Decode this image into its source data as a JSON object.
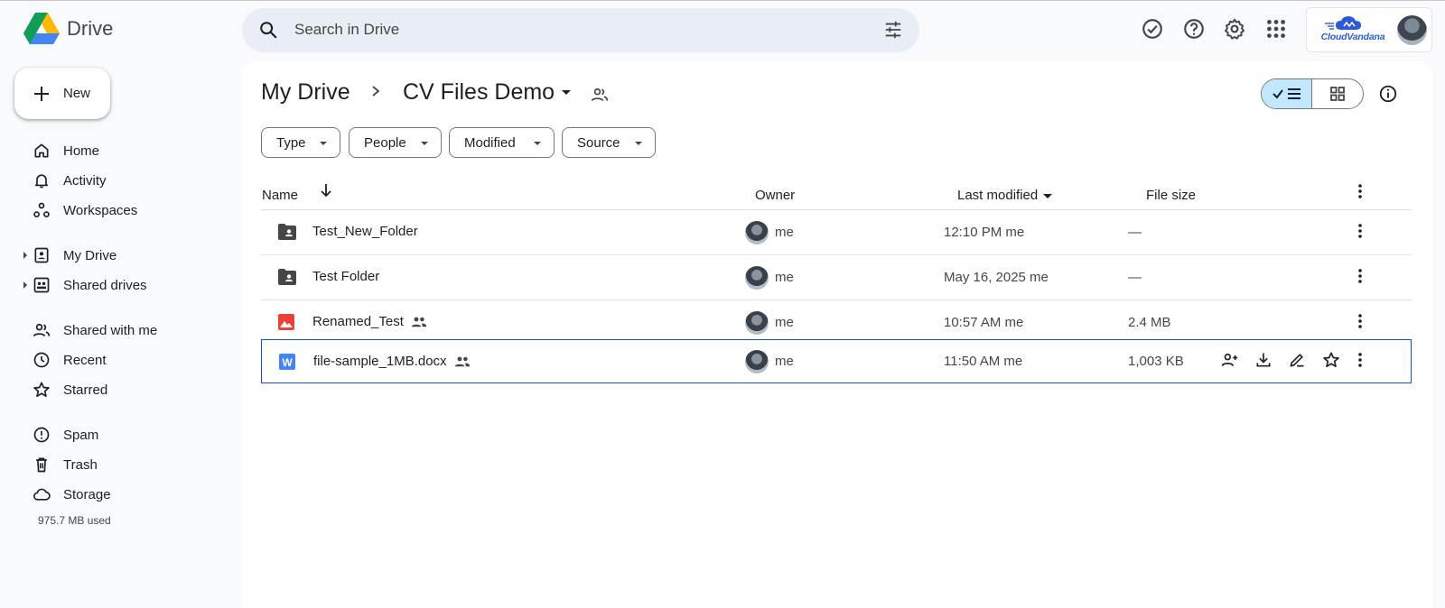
{
  "app": {
    "name": "Drive",
    "search_placeholder": "Search in Drive",
    "account_brand": "CloudVandana"
  },
  "new_button": {
    "label": "New"
  },
  "sidebar": {
    "items": [
      {
        "label": "Home"
      },
      {
        "label": "Activity"
      },
      {
        "label": "Workspaces"
      },
      {
        "label": "My Drive"
      },
      {
        "label": "Shared drives"
      },
      {
        "label": "Shared with me"
      },
      {
        "label": "Recent"
      },
      {
        "label": "Starred"
      },
      {
        "label": "Spam"
      },
      {
        "label": "Trash"
      },
      {
        "label": "Storage"
      }
    ],
    "storage_used": "975.7 MB used"
  },
  "breadcrumb": {
    "root": "My Drive",
    "current": "CV Files Demo"
  },
  "filters": [
    "Type",
    "People",
    "Modified",
    "Source"
  ],
  "table": {
    "headers": {
      "name": "Name",
      "owner": "Owner",
      "modified": "Last modified",
      "size": "File size"
    },
    "rows": [
      {
        "name": "Test_New_Folder",
        "owner": "me",
        "modified": "12:10 PM me",
        "size": "—"
      },
      {
        "name": "Test Folder",
        "owner": "me",
        "modified": "May 16, 2025 me",
        "size": "—"
      },
      {
        "name": "Renamed_Test",
        "owner": "me",
        "modified": "10:57 AM me",
        "size": "2.4 MB"
      },
      {
        "name": "file-sample_1MB.docx",
        "owner": "me",
        "modified": "11:50 AM me",
        "size": "1,003 KB"
      }
    ]
  },
  "colors": {
    "accent": "#0b57d0",
    "selected_toggle": "#c2e7ff",
    "search_bg": "#e9eef6",
    "page_bg": "#f8fafd"
  }
}
